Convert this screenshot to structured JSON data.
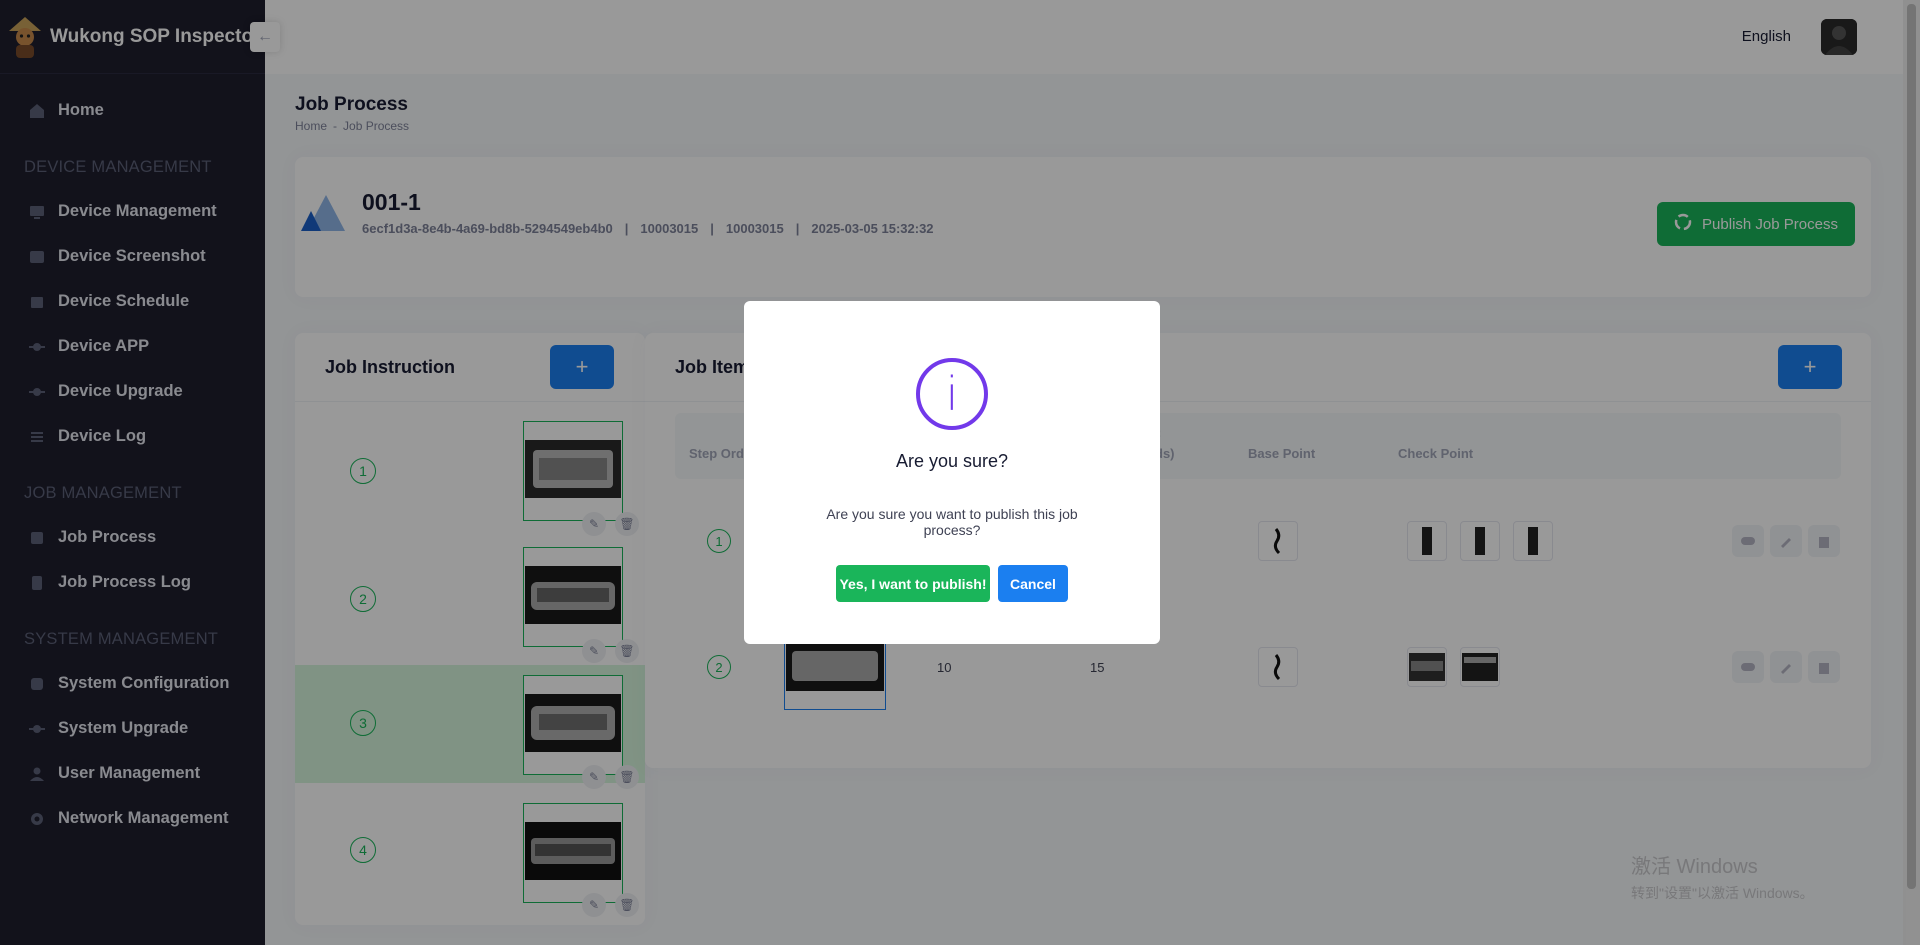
{
  "brand": {
    "title": "Wukong SOP Inspector",
    "logo": "wukong-logo"
  },
  "header": {
    "language": "English",
    "collapse_icon": "arrow-left-icon"
  },
  "sidebar": {
    "home": "Home",
    "sections": [
      {
        "title": "DEVICE MANAGEMENT",
        "items": [
          "Device Management",
          "Device Screenshot",
          "Device Schedule",
          "Device APP",
          "Device Upgrade",
          "Device Log"
        ]
      },
      {
        "title": "JOB MANAGEMENT",
        "items": [
          "Job Process",
          "Job Process Log"
        ]
      },
      {
        "title": "SYSTEM MANAGEMENT",
        "items": [
          "System Configuration",
          "System Upgrade",
          "User Management",
          "Network Management"
        ]
      }
    ]
  },
  "page": {
    "title": "Job Process",
    "breadcrumb": [
      "Home",
      "Job Process"
    ],
    "breadcrumb_sep": "-"
  },
  "job": {
    "name": "001-1",
    "id": "6ecf1d3a-8e4b-4a69-bd8b-5294549eb4b0",
    "code1": "10003015",
    "code2": "10003015",
    "datetime": "2025-03-05 15:32:32",
    "meta_sep": "|",
    "publish_label": "Publish Job Process"
  },
  "instruction": {
    "title": "Job Instruction",
    "add_label": "+",
    "steps": [
      "1",
      "2",
      "3",
      "4"
    ],
    "active_step": "3"
  },
  "items": {
    "title": "Job Item",
    "add_label": "+",
    "columns": {
      "step_order": "Step Ord",
      "col3_line1": ":",
      "col3_line2": "ds)",
      "base_point": "Base Point",
      "check_point": "Check Point"
    },
    "rows": [
      {
        "step": "1",
        "check_points": 3
      },
      {
        "step": "2",
        "value_a": "10",
        "value_b": "15",
        "check_points": 2
      }
    ]
  },
  "watermark": {
    "line1": "激活 Windows",
    "line2": "转到\"设置\"以激活 Windows。"
  },
  "dialog": {
    "icon": "info-icon",
    "icon_glyph": "i",
    "title": "Are you sure?",
    "text": "Are you sure you want to publish this job process?",
    "confirm_label": "Yes, I want to publish!",
    "cancel_label": "Cancel"
  },
  "colors": {
    "sidebar": "#1e1e2d",
    "success": "#1ab55a",
    "primary": "#1b7ff0",
    "dialog_icon": "#7239ea",
    "active_row": "#d6f5dc"
  }
}
